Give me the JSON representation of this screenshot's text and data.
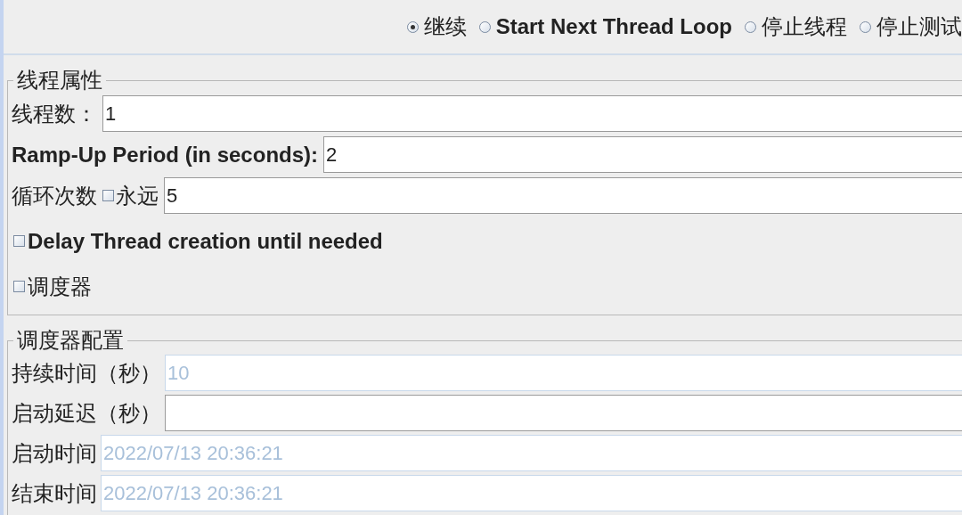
{
  "on_sample_error": {
    "options": [
      {
        "label": "继续",
        "selected": true
      },
      {
        "label": "Start Next Thread Loop",
        "selected": false
      },
      {
        "label": "停止线程",
        "selected": false
      },
      {
        "label": "停止测试",
        "selected": false
      }
    ]
  },
  "thread_properties": {
    "legend": "线程属性",
    "rows": [
      {
        "kind": "field",
        "label": "线程数：",
        "value": "1"
      },
      {
        "kind": "field",
        "label": "Ramp-Up Period (in seconds):",
        "value": "2"
      },
      {
        "kind": "loop",
        "label": "循环次数",
        "forever": {
          "label": "永远",
          "checked": false
        },
        "value": "5"
      },
      {
        "kind": "checkbox",
        "label": "Delay Thread creation until needed",
        "checked": false
      },
      {
        "kind": "checkbox",
        "label": "调度器",
        "checked": false
      }
    ]
  },
  "scheduler": {
    "legend": "调度器配置",
    "fields": [
      {
        "label": "持续时间（秒）",
        "value": "10",
        "disabled": true
      },
      {
        "label": "启动延迟（秒）",
        "disabled": false
      },
      {
        "label": "启动时间",
        "value": "2022/07/13 20:36:21",
        "disabled": true
      },
      {
        "label": "结束时间",
        "value": "2022/07/13 20:36:21",
        "disabled": true
      }
    ]
  }
}
